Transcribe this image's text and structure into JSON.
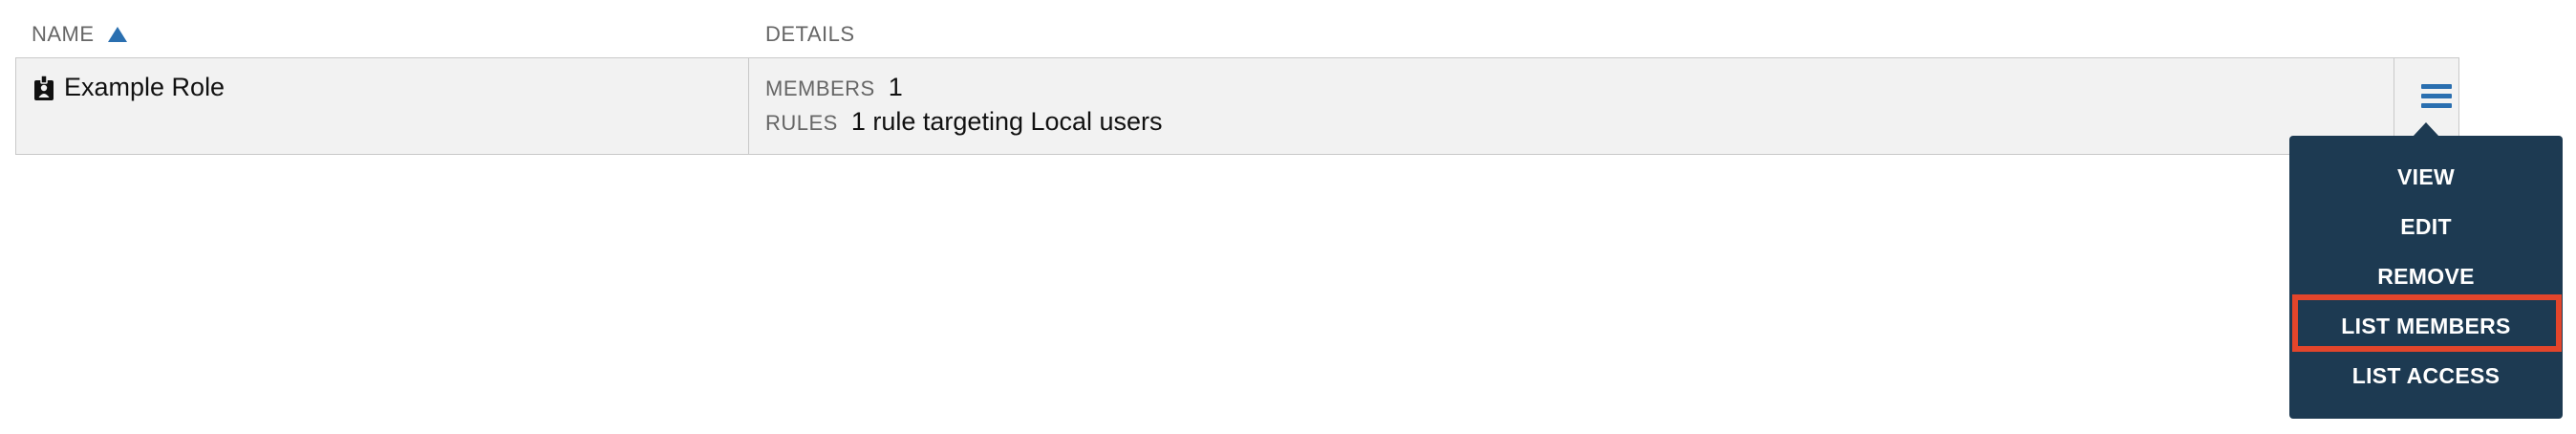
{
  "table": {
    "headers": {
      "name": "NAME",
      "details": "DETAILS"
    },
    "sort": {
      "column": "name",
      "direction": "ascending",
      "icon": "sort-ascending-icon"
    },
    "rows": [
      {
        "name": "Example Role",
        "icon": "badge-icon",
        "details": [
          {
            "key": "MEMBERS",
            "value": "1"
          },
          {
            "key": "RULES",
            "value": "1 rule targeting Local users"
          }
        ]
      }
    ]
  },
  "menu": {
    "trigger_icon": "hamburger-menu-icon",
    "items": [
      {
        "label": "VIEW"
      },
      {
        "label": "EDIT"
      },
      {
        "label": "REMOVE"
      },
      {
        "label": "LIST MEMBERS",
        "highlighted": true
      },
      {
        "label": "LIST ACCESS"
      }
    ]
  },
  "colors": {
    "accent": "#2a6fb0",
    "menu_background": "#1d3a52",
    "highlight": "#e3452b",
    "row_background": "#f2f2f2"
  }
}
